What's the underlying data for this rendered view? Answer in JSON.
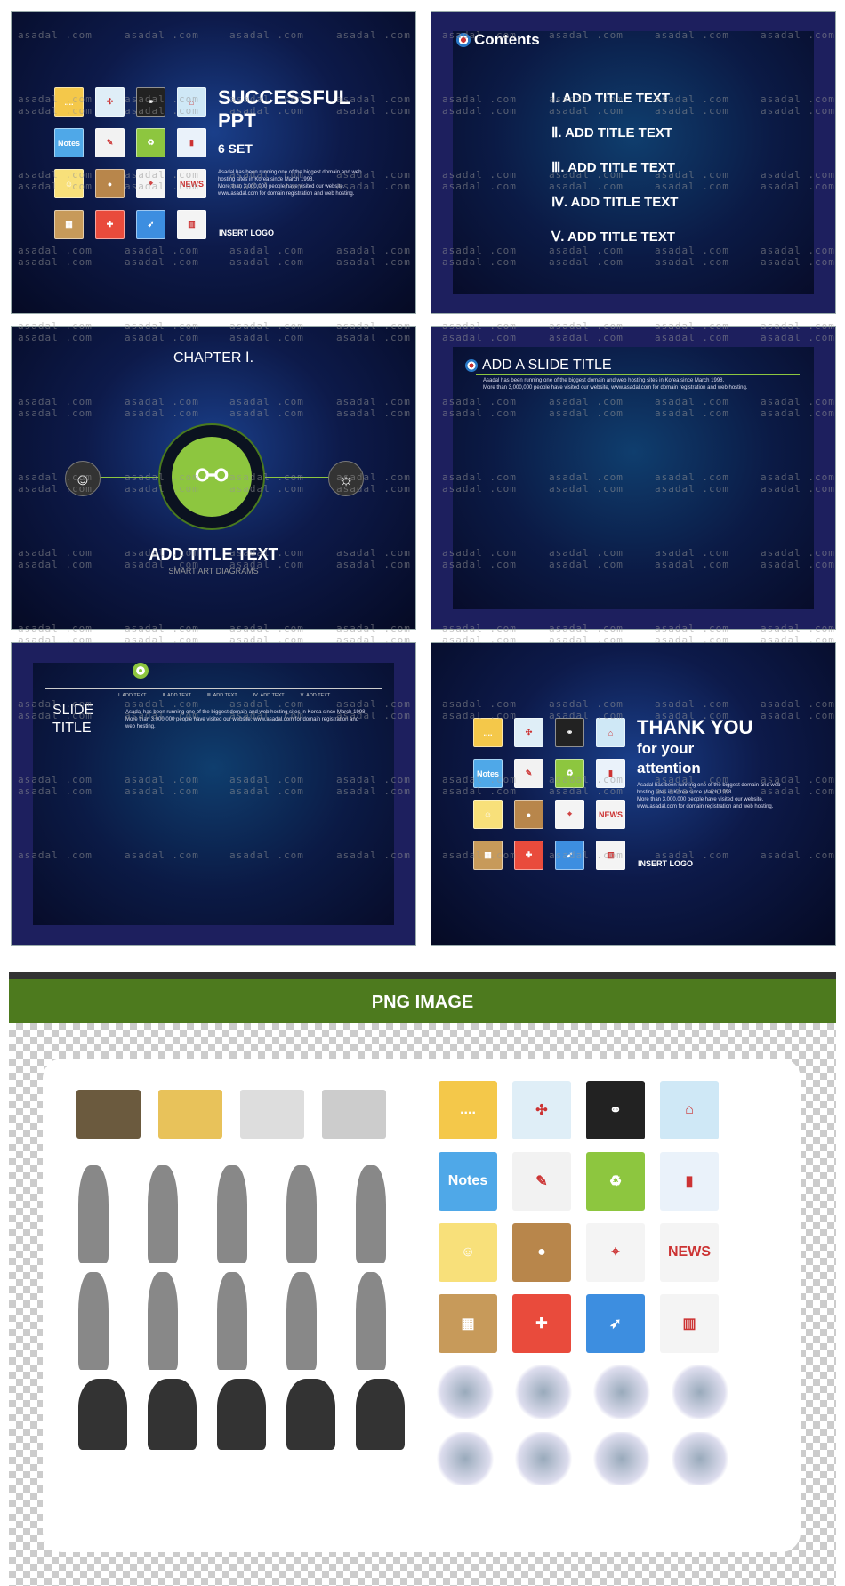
{
  "watermark": "asadal .com",
  "icons": [
    {
      "name": "mail-icon",
      "color": "#f4c84a",
      "label": "...."
    },
    {
      "name": "pinwheel-icon",
      "color": "#dfeef7",
      "label": "✣"
    },
    {
      "name": "molecule-icon",
      "color": "#222",
      "label": "⚭"
    },
    {
      "name": "house-icon",
      "color": "#cfe8f6",
      "label": "⌂"
    },
    {
      "name": "notes-icon",
      "color": "#4fa8e8",
      "label": "Notes"
    },
    {
      "name": "notebook-pencil-icon",
      "color": "#f2f2f2",
      "label": "✎"
    },
    {
      "name": "recycle-icon",
      "color": "#8dc63f",
      "label": "♻"
    },
    {
      "name": "paint-roller-icon",
      "color": "#eaf2fa",
      "label": "▮"
    },
    {
      "name": "sticky-note-smiley-icon",
      "color": "#f8e07a",
      "label": "☺"
    },
    {
      "name": "coffee-cup-icon",
      "color": "#b8864b",
      "label": "●"
    },
    {
      "name": "map-icon",
      "color": "#f4f4f4",
      "label": "⌖"
    },
    {
      "name": "news-icon",
      "color": "#f4f4f4",
      "label": "NEWS"
    },
    {
      "name": "bookshelf-icon",
      "color": "#c79a5a",
      "label": "▦"
    },
    {
      "name": "puzzle-icon",
      "color": "#e94b3c",
      "label": "✚"
    },
    {
      "name": "compass-icon",
      "color": "#3d8ee0",
      "label": "➶"
    },
    {
      "name": "bar-chart-medal-icon",
      "color": "#f4f4f4",
      "label": "▥"
    }
  ],
  "accent": "#8dc63f",
  "slide1": {
    "title1": "SUCCESSFUL",
    "title2": "PPT",
    "subtitle": "6 SET",
    "body": [
      "Asadal has been running one of the biggest domain and web",
      "hosting sites in Korea since March 1998.",
      "More than 3,000,000 people have visited our website.",
      "www.asadal.com for domain registration and web hosting."
    ],
    "logo": "INSERT LOGO"
  },
  "slide2": {
    "title": "Contents",
    "items": [
      "Ⅰ. ADD TITLE TEXT",
      "Ⅱ. ADD TITLE TEXT",
      "Ⅲ. ADD TITLE TEXT",
      "Ⅳ. ADD TITLE TEXT",
      "Ⅴ. ADD TITLE TEXT"
    ]
  },
  "slide3": {
    "chapter": "CHAPTER Ⅰ.",
    "title": "ADD TITLE TEXT",
    "subtitle": "SMART ART DIAGRAMS"
  },
  "slide4": {
    "title": "ADD A SLIDE TITLE",
    "body": [
      "Asadal has been running one of the biggest domain and web hosting sites in Korea since March 1998.",
      "More than 3,000,000 people have visited our website,  www.asadal.com  for domain registration and web hosting."
    ]
  },
  "slide5": {
    "title1": "SLIDE",
    "title2": "TITLE",
    "steps": [
      "Ⅰ. ADD TEXT",
      "Ⅱ. ADD TEXT",
      "Ⅲ. ADD TEXT",
      "Ⅳ. ADD TEXT",
      "Ⅴ. ADD TEXT"
    ],
    "body": [
      "Asadal has been running one of the biggest domain and web hosting sites in Korea since March 1998.",
      "More than 3,000,000 people have visited our website,  www.asadal.com  for domain registration and",
      "web hosting."
    ]
  },
  "slide6": {
    "title": "THANK YOU",
    "line2": "for your",
    "line3": "attention",
    "body": [
      "Asadal has been running one of the biggest domain and web",
      "hosting sites in Korea since March 1998.",
      "More than 3,000,000 people have visited our website.",
      "www.asadal.com for domain registration and web hosting."
    ],
    "logo": "INSERT LOGO"
  },
  "png_section": {
    "title": "PNG IMAGE",
    "left_items": [
      "faq-chalkboard-icon",
      "colored-pencils-icon",
      "education-scroll-icon",
      "book-alarm-clock-icon"
    ],
    "objects": [
      "city-island-icon",
      "3d-bar-chart-icon",
      "growth-arrow-icon",
      "stairs-success-icon",
      "open-book-icon",
      "globe-icon",
      "lightbulb-globe-icon",
      "city-skyline-icon"
    ]
  }
}
